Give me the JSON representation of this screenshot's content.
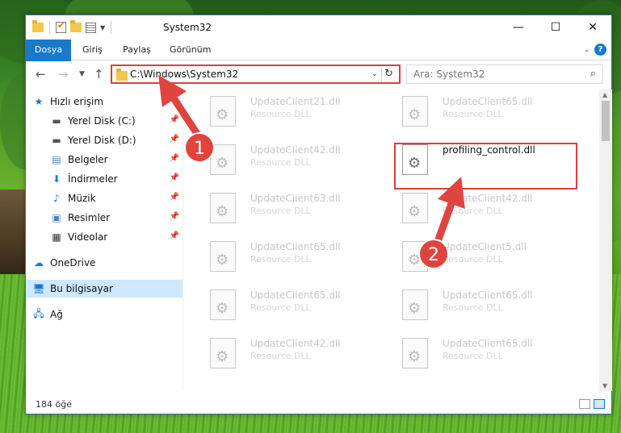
{
  "window": {
    "title": "System32",
    "controls": {
      "minimize": "—",
      "maximize": "☐",
      "close": "✕"
    }
  },
  "ribbon": {
    "tabs": [
      {
        "label": "Dosya"
      },
      {
        "label": "Giriş"
      },
      {
        "label": "Paylaş"
      },
      {
        "label": "Görünüm"
      }
    ],
    "help": "?"
  },
  "navigation": {
    "address_path": "C:\\Windows\\System32",
    "search_placeholder": "Ara: System32"
  },
  "sidebar": {
    "items": [
      {
        "label": "Hızlı erişim",
        "icon": "star-icon"
      },
      {
        "label": "Yerel Disk (C:)",
        "icon": "drive-icon",
        "pinned": true
      },
      {
        "label": "Yerel Disk (D:)",
        "icon": "drive-icon",
        "pinned": true
      },
      {
        "label": "Belgeler",
        "icon": "documents-icon",
        "pinned": true
      },
      {
        "label": "İndirmeler",
        "icon": "download-icon",
        "pinned": true
      },
      {
        "label": "Müzik",
        "icon": "music-icon",
        "pinned": true
      },
      {
        "label": "Resimler",
        "icon": "pictures-icon",
        "pinned": true
      },
      {
        "label": "Videolar",
        "icon": "video-icon",
        "pinned": true
      },
      {
        "label": "OneDrive",
        "icon": "cloud-icon"
      },
      {
        "label": "Bu bilgisayar",
        "icon": "computer-icon",
        "selected": true
      },
      {
        "label": "Ağ",
        "icon": "network-icon"
      }
    ]
  },
  "files": {
    "left": [
      {
        "name": "UpdateClient21.dll",
        "type": "Resource DLL"
      },
      {
        "name": "UpdateClient42.dll",
        "type": "Resource DLL"
      },
      {
        "name": "UpdateClient63.dll",
        "type": "Resource DLL"
      },
      {
        "name": "UpdateClient65.dll",
        "type": "Resource DLL"
      },
      {
        "name": "UpdateClient65.dll",
        "type": "Resource DLL"
      },
      {
        "name": "UpdateClient42.dll",
        "type": "Resource DLL"
      }
    ],
    "right": [
      {
        "name": "UpdateClient65.dll",
        "type": "Resource DLL"
      },
      {
        "name": "profiling_control.dll",
        "type": "",
        "focused": true
      },
      {
        "name": "UpdateClient42.dll",
        "type": "Resource DLL"
      },
      {
        "name": "UpdateClient5.dll",
        "type": "Resource DLL"
      },
      {
        "name": "UpdateClient65.dll",
        "type": "Resource DLL"
      },
      {
        "name": "UpdateClient65.dll",
        "type": "Resource DLL"
      }
    ]
  },
  "status": {
    "item_count": "184 öğe"
  },
  "annotations": {
    "step1": "1",
    "step2": "2",
    "accent_color": "#e0443e"
  }
}
